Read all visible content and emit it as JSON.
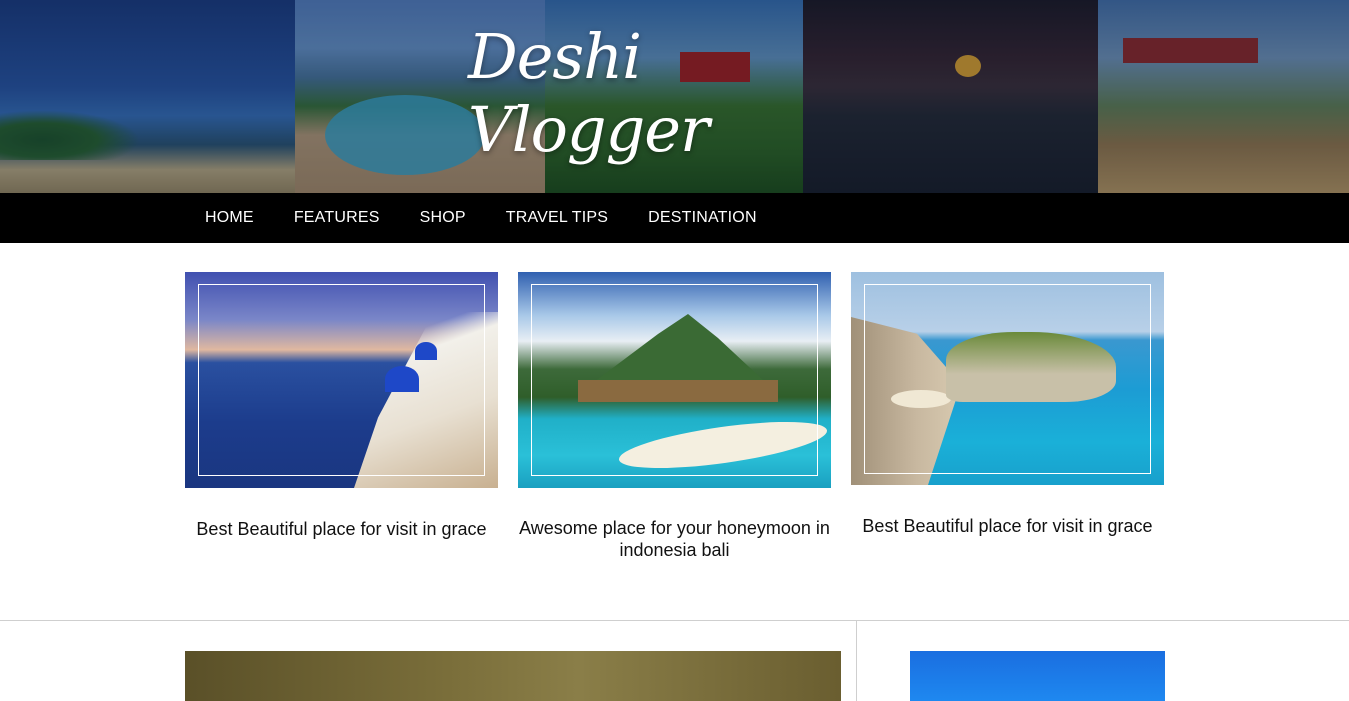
{
  "site": {
    "logo_text": "Deshi Vlogger"
  },
  "nav": {
    "items": [
      {
        "label": "HOME"
      },
      {
        "label": "FEATURES"
      },
      {
        "label": "SHOP"
      },
      {
        "label": "TRAVEL TIPS"
      },
      {
        "label": "DESTINATION"
      }
    ]
  },
  "featured": [
    {
      "title": "Best Beautiful place for visit in grace"
    },
    {
      "title": "Awesome place for your honeymoon in indonesia bali"
    },
    {
      "title": "Best Beautiful place for visit in grace"
    }
  ]
}
